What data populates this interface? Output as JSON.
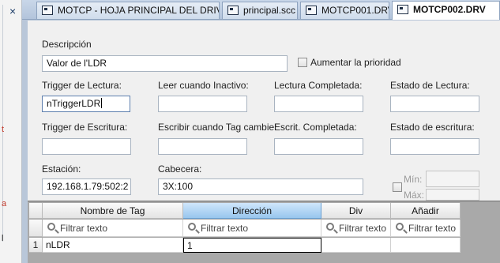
{
  "left_panel": {
    "close_glyph": "×",
    "glyphs": [
      "t",
      "a",
      "l"
    ]
  },
  "tabs": [
    {
      "label": "MOTCP - HOJA PRINCIPAL DEL DRIVER",
      "active": false
    },
    {
      "label": "principal.scc",
      "active": false
    },
    {
      "label": "MOTCP001.DRV",
      "active": false
    },
    {
      "label": "MOTCP002.DRV",
      "active": true
    }
  ],
  "form": {
    "description_label": "Descripción",
    "description_value": "Valor de l'LDR",
    "increase_priority_label": "Aumentar la prioridad",
    "increase_priority_checked": false,
    "trigger_read_label": "Trigger de Lectura:",
    "trigger_read_value": "nTriggerLDR",
    "read_inactive_label": "Leer cuando Inactivo:",
    "read_inactive_value": "",
    "read_complete_label": "Lectura Completada:",
    "read_complete_value": "",
    "read_status_label": "Estado de Lectura:",
    "read_status_value": "",
    "trigger_write_label": "Trigger de Escritura:",
    "trigger_write_value": "",
    "write_on_change_label": "Escribir cuando Tag cambie:",
    "write_on_change_value": "",
    "write_complete_label": "Escrit. Completada:",
    "write_complete_value": "",
    "write_status_label": "Estado de escritura:",
    "write_status_value": "",
    "station_label": "Estación:",
    "station_value": "192.168.1.79:502:2",
    "header_label": "Cabecera:",
    "header_value": "3X:100",
    "min_label": "Mín:",
    "max_label": "Máx:"
  },
  "grid": {
    "columns": [
      "Nombre de Tag",
      "Dirección",
      "Div",
      "Añadir"
    ],
    "filter_placeholder": "Filtrar texto",
    "rows": [
      {
        "index": "1",
        "tag": "nLDR",
        "address": "1",
        "div": "",
        "add": ""
      }
    ]
  }
}
